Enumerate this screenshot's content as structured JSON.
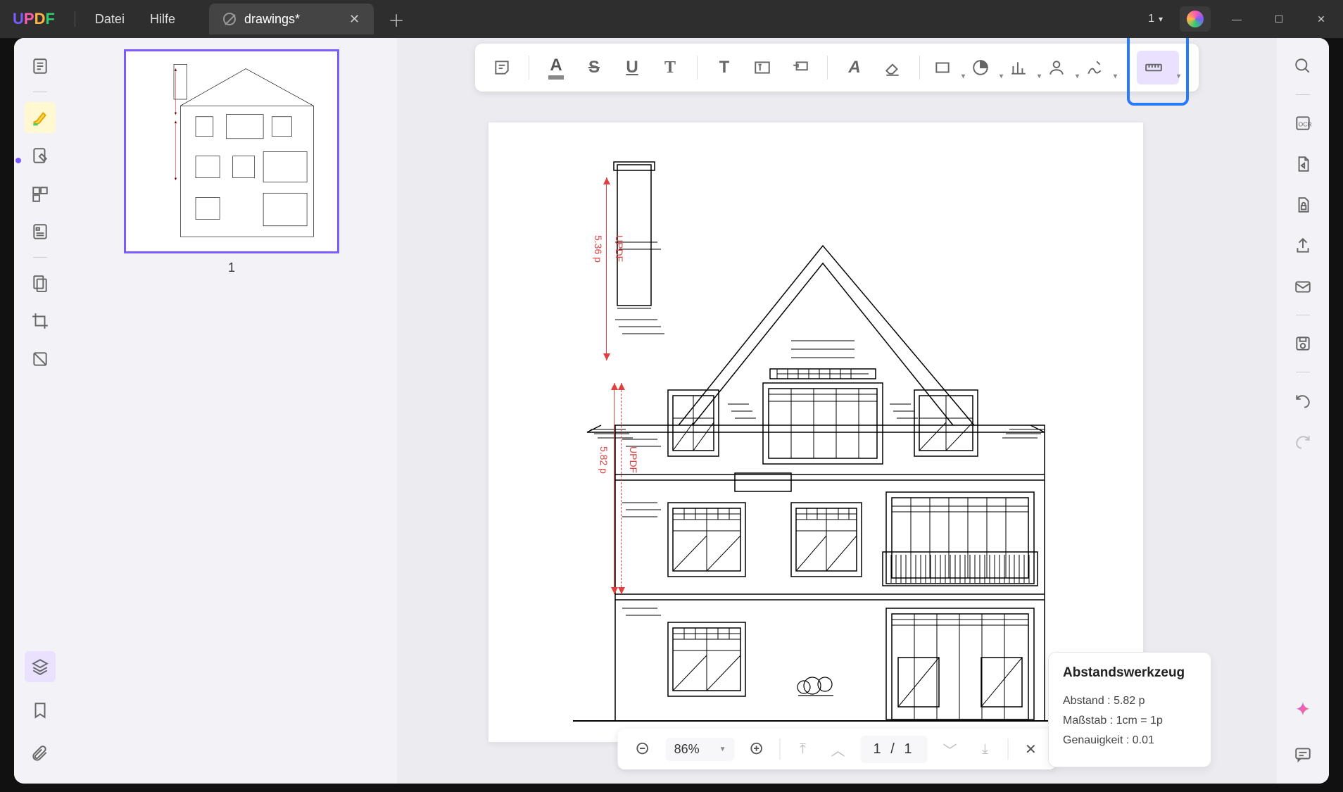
{
  "app": {
    "logo": "UPDF"
  },
  "menu": {
    "file": "Datei",
    "help": "Hilfe"
  },
  "tab": {
    "title": "drawings*"
  },
  "titlebar": {
    "page_indicator": "1"
  },
  "thumbnails": {
    "page1_num": "1"
  },
  "toolbar": {
    "highlight": "A",
    "strike": "S",
    "underline": "U",
    "text1": "T",
    "text2": "T",
    "pencil": "A"
  },
  "zoom": {
    "value": "86%"
  },
  "pager": {
    "current": "1",
    "sep": "/",
    "total": "1"
  },
  "measure_panel": {
    "title": "Abstandswerkzeug",
    "distance_label": "Abstand :",
    "distance_value": "5.82 p",
    "scale_label": "Maßstab :",
    "scale_value": "1cm = 1p",
    "precision_label": "Genauigkeit :",
    "precision_value": "0.01"
  },
  "drawing": {
    "m1_value": "5.36 p",
    "m1_label": "UPDF",
    "m2_value": "5.82 p",
    "m2_label": "UPDF"
  }
}
